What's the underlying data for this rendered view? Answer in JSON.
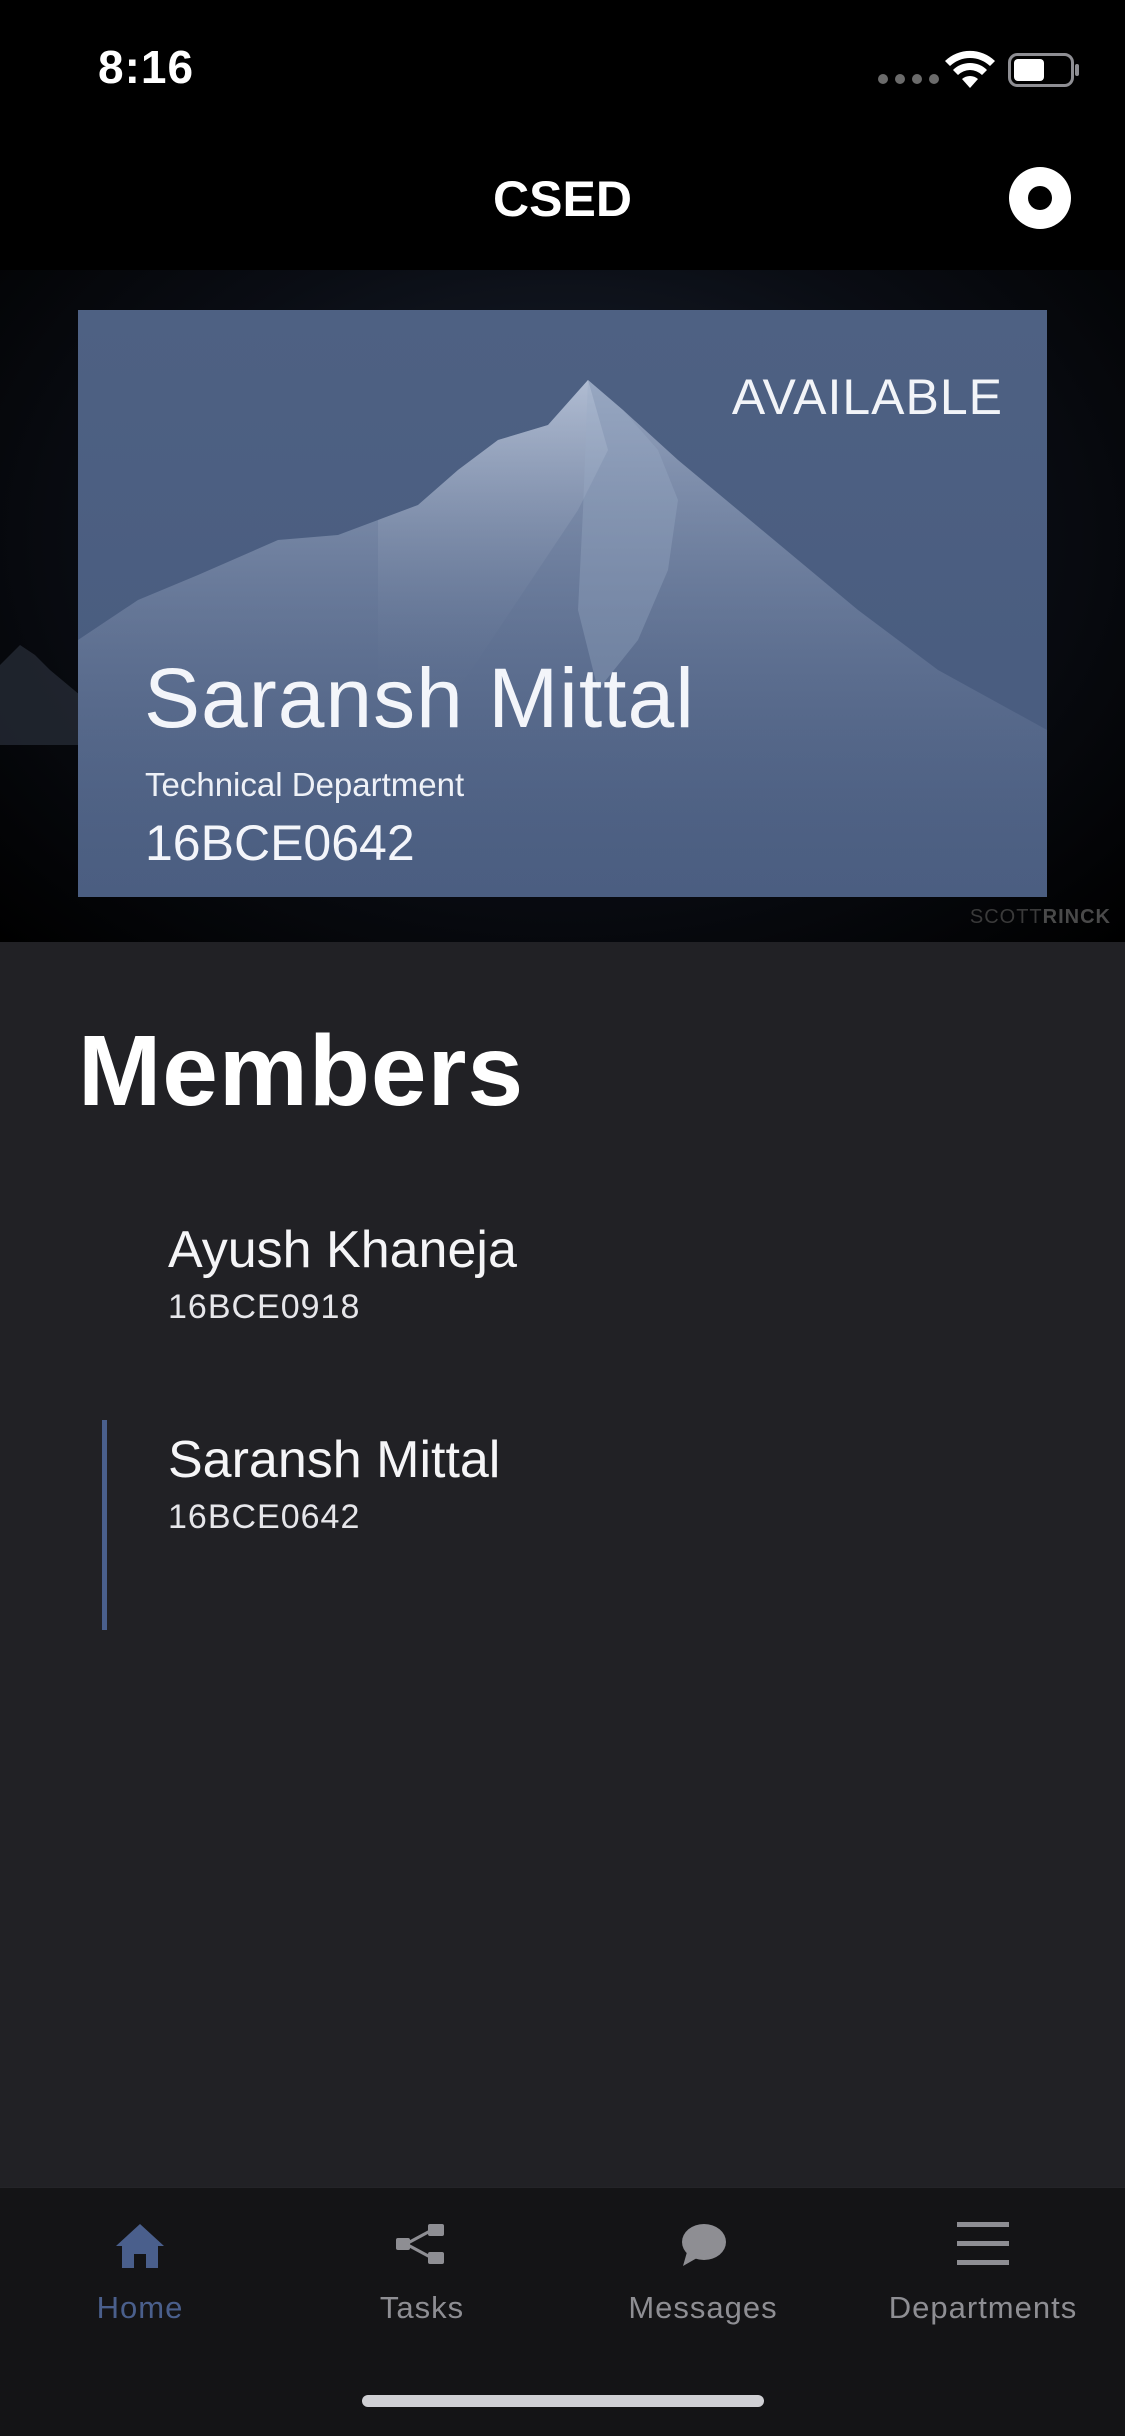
{
  "status_bar": {
    "time": "8:16"
  },
  "nav": {
    "title": "CSED",
    "record_icon": "record-icon"
  },
  "profile_card": {
    "status": "AVAILABLE",
    "name": "Saransh Mittal",
    "department": "Technical Department",
    "id": "16BCE0642",
    "watermark_a": "SCOTT",
    "watermark_b": "RINCK",
    "background_color": "#4e6183"
  },
  "members": {
    "title": "Members",
    "items": [
      {
        "name": "Ayush Khaneja",
        "id": "16BCE0918",
        "selected": false
      },
      {
        "name": "Saransh Mittal",
        "id": "16BCE0642",
        "selected": true
      }
    ]
  },
  "tab_bar": {
    "tabs": [
      {
        "label": "Home",
        "icon": "home-icon",
        "active": true
      },
      {
        "label": "Tasks",
        "icon": "share-nodes-icon",
        "active": false
      },
      {
        "label": "Messages",
        "icon": "chat-bubble-icon",
        "active": false
      },
      {
        "label": "Departments",
        "icon": "menu-icon",
        "active": false
      }
    ]
  },
  "colors": {
    "accent": "#4a5f8c",
    "section_background": "#212125",
    "tab_inactive": "#8e8e93"
  }
}
